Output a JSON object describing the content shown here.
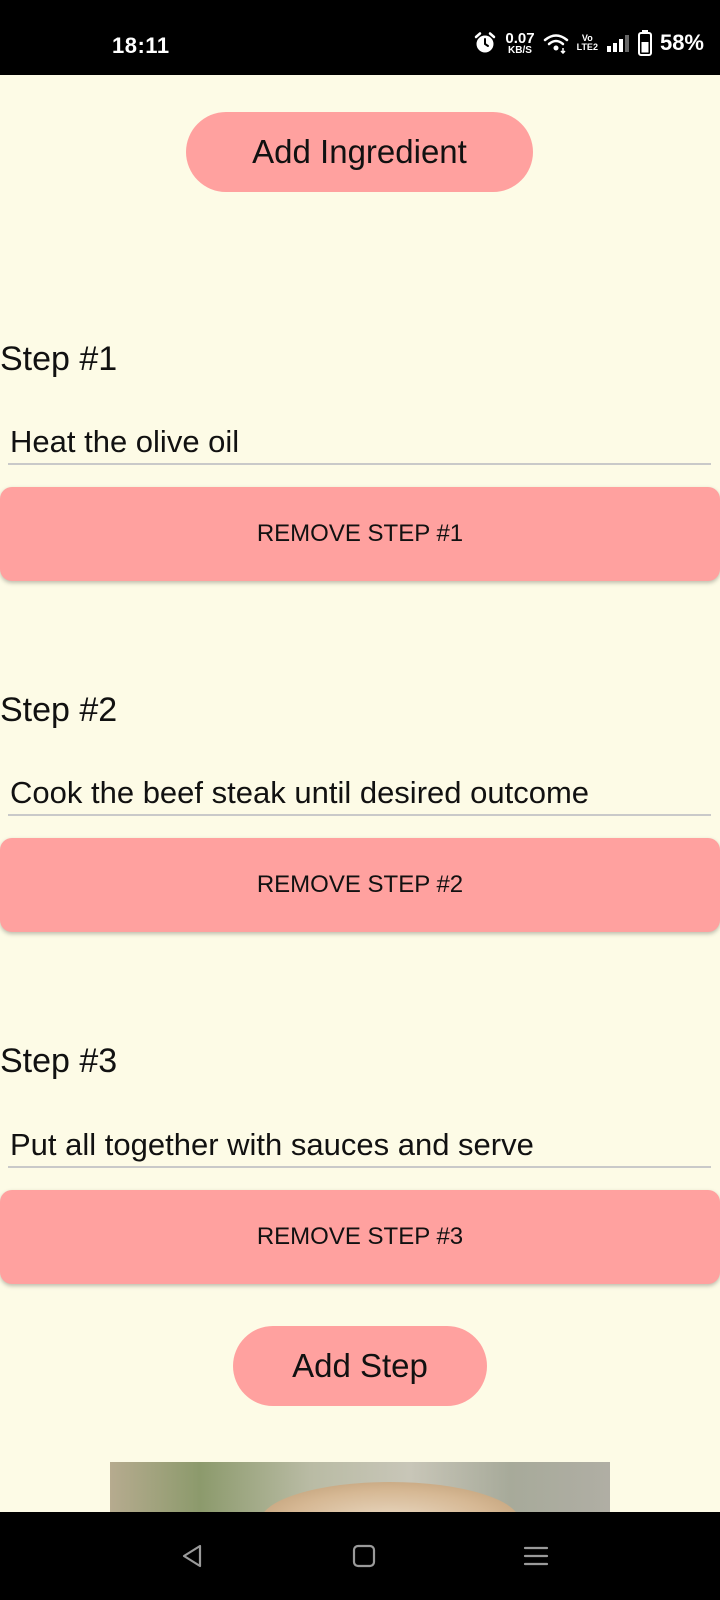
{
  "status_bar": {
    "time": "18:11",
    "net_speed_value": "0.07",
    "net_speed_unit": "KB/S",
    "volte_top": "Vo",
    "volte_bottom": "LTE2",
    "battery_percent": "58%",
    "icons": [
      "alarm-icon",
      "wifi-icon",
      "signal-icon",
      "battery-icon"
    ]
  },
  "add_ingredient_label": "Add Ingredient",
  "steps": [
    {
      "title": "Step #1",
      "value": "Heat the olive oil",
      "remove_label": "REMOVE STEP #1"
    },
    {
      "title": "Step #2",
      "value": "Cook the beef steak until desired outcome",
      "remove_label": "REMOVE STEP #2"
    },
    {
      "title": "Step #3",
      "value": "Put all together with sauces and serve",
      "remove_label": "REMOVE STEP #3"
    }
  ],
  "add_step_label": "Add Step",
  "colors": {
    "background": "#fdfbe6",
    "button": "#ffa19f",
    "input_underline": "#c9c9c9"
  },
  "nav_bar": {
    "icons": [
      "back-icon",
      "home-icon",
      "recents-icon"
    ]
  }
}
